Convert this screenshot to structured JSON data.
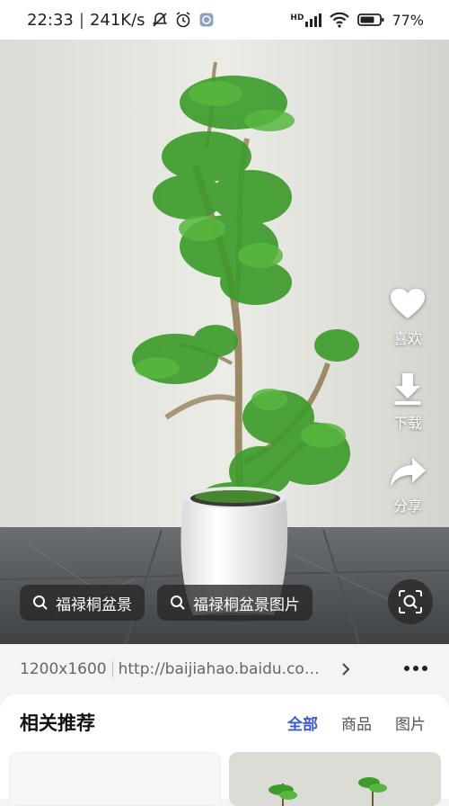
{
  "status_bar": {
    "time": "22:33",
    "speed": "241K/s",
    "network": "HD",
    "battery": "77%"
  },
  "actions": {
    "like": "喜欢",
    "download": "下载",
    "share": "分享"
  },
  "search_chips": [
    {
      "label": "福禄桐盆景"
    },
    {
      "label": "福禄桐盆景图片"
    }
  ],
  "info": {
    "resolution": "1200x1600",
    "url": "http://baijiahao.baidu.com/..."
  },
  "recommendations": {
    "title": "相关推荐",
    "tabs": [
      "全部",
      "商品",
      "图片"
    ],
    "active_tab": "全部"
  },
  "colors": {
    "accent": "#3a5ccc",
    "leaf": "#3e9b2c",
    "wall": "#e9e9e4",
    "floor": "#5a5e62"
  },
  "icons": [
    "search-icon",
    "heart-icon",
    "download-icon",
    "share-icon",
    "lens-icon",
    "more-icon",
    "chevron-right-icon"
  ]
}
